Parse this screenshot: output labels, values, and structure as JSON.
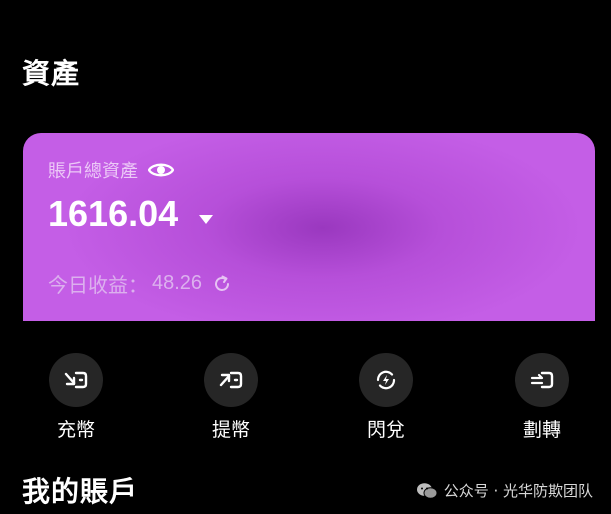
{
  "header": {
    "title": "資產"
  },
  "asset_card": {
    "label": "賬戶總資產",
    "balance": "1616.04",
    "income_label": "今日收益：",
    "income_value": "48.26"
  },
  "actions": [
    {
      "label": "充幣",
      "icon": "deposit-icon"
    },
    {
      "label": "提幣",
      "icon": "withdraw-icon"
    },
    {
      "label": "閃兌",
      "icon": "flash-swap-icon"
    },
    {
      "label": "劃轉",
      "icon": "transfer-icon"
    }
  ],
  "accounts_section": {
    "title": "我的賬戶"
  },
  "watermark": {
    "text": "公众号 · 光华防欺团队",
    "icon": "wechat-icon"
  },
  "colors": {
    "background": "#000000",
    "card_gradient_start": "#c45ee6",
    "card_gradient_center": "#9a38bf",
    "action_circle": "#262626"
  }
}
